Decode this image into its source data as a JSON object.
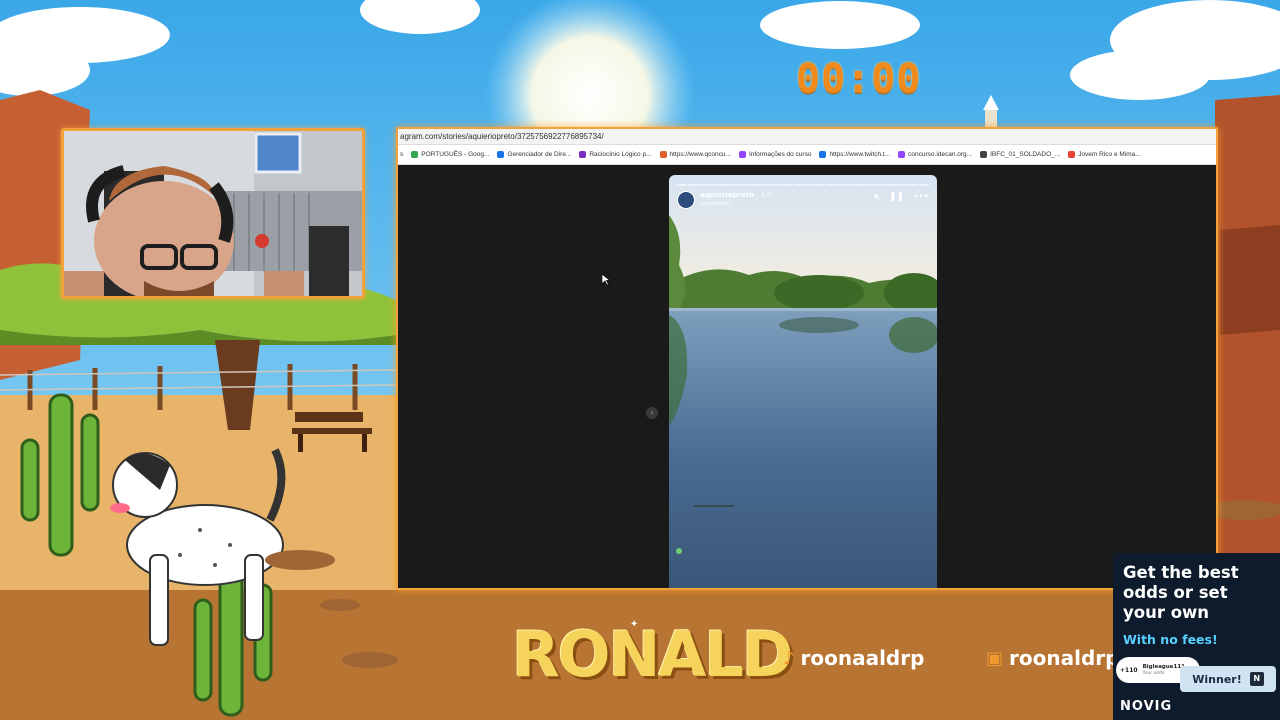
{
  "overlay": {
    "timer": "00:00",
    "brand": "RONALD",
    "social": [
      {
        "icon": "tiktok-icon",
        "handle": "roonaaldrp"
      },
      {
        "icon": "twitch-icon",
        "handle": "roonaldrp"
      }
    ]
  },
  "browser": {
    "url": "agram.com/stories/aquieriopreto/3725756922776895734/",
    "bookmarks": [
      {
        "label": "s",
        "color": "#5f6368"
      },
      {
        "label": "PORTUGUÊS - Goog...",
        "color": "#34a853"
      },
      {
        "label": "Gerenciador de Dire...",
        "color": "#1a73e8"
      },
      {
        "label": "Raciocínio Lógico p...",
        "color": "#7b2cbf"
      },
      {
        "label": "https://www.qconcu...",
        "color": "#e2602a"
      },
      {
        "label": "Informações do curso",
        "color": "#9146ff"
      },
      {
        "label": "https://www.twitch.t...",
        "color": "#1a73e8"
      },
      {
        "label": "concurso.idecan.org...",
        "color": "#9146ff"
      },
      {
        "label": "IBFC_01_SOLDADO_...",
        "color": "#444444"
      },
      {
        "label": "Jovem Rico e Mima...",
        "color": "#ea4335"
      }
    ]
  },
  "story": {
    "username": "aquieriopreto",
    "time": "4 h",
    "subtitle": "aqueleklen"
  },
  "ad": {
    "headline": "Get the best odds or set your own",
    "subline": "With no fees!",
    "card_odds": "+110",
    "card_name": "Bigleague111",
    "card_small": "Your odds",
    "winner_label": "Winner!",
    "brand": "NOVIG"
  }
}
